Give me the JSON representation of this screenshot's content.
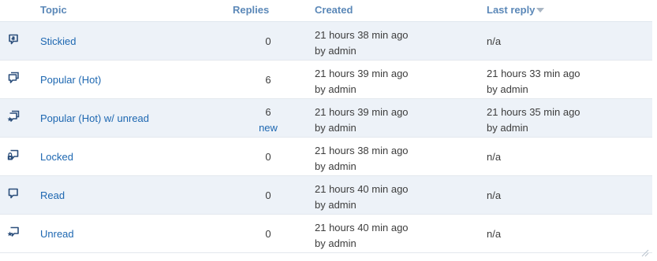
{
  "header": {
    "topic": "Topic",
    "replies": "Replies",
    "created": "Created",
    "last_reply": "Last reply"
  },
  "rows": [
    {
      "icon": "stickied-topic-icon",
      "topic": "Stickied",
      "replies": "0",
      "new": "",
      "created_time": "21 hours 38 min ago",
      "created_by": "by admin",
      "last_time": "",
      "last_by": "",
      "last_na": "n/a"
    },
    {
      "icon": "hot-topic-icon",
      "topic": "Popular (Hot)",
      "replies": "6",
      "new": "",
      "created_time": "21 hours 39 min ago",
      "created_by": "by admin",
      "last_time": "21 hours 33 min ago",
      "last_by": "by admin",
      "last_na": ""
    },
    {
      "icon": "hot-unread-topic-icon",
      "topic": "Popular (Hot) w/ unread",
      "replies": "6",
      "new": "new",
      "created_time": "21 hours 39 min ago",
      "created_by": "by admin",
      "last_time": "21 hours 35 min ago",
      "last_by": "by admin",
      "last_na": ""
    },
    {
      "icon": "locked-topic-icon",
      "topic": "Locked",
      "replies": "0",
      "new": "",
      "created_time": "21 hours 38 min ago",
      "created_by": "by admin",
      "last_time": "",
      "last_by": "",
      "last_na": "n/a"
    },
    {
      "icon": "read-topic-icon",
      "topic": "Read",
      "replies": "0",
      "new": "",
      "created_time": "21 hours 40 min ago",
      "created_by": "by admin",
      "last_time": "",
      "last_by": "",
      "last_na": "n/a"
    },
    {
      "icon": "unread-topic-icon",
      "topic": "Unread",
      "replies": "0",
      "new": "",
      "created_time": "21 hours 40 min ago",
      "created_by": "by admin",
      "last_time": "",
      "last_by": "",
      "last_na": "n/a"
    }
  ],
  "colors": {
    "header_text": "#5b88b8",
    "link": "#1d67b1",
    "row_stripe": "#edf2f8",
    "icon": "#2c4f7c"
  }
}
